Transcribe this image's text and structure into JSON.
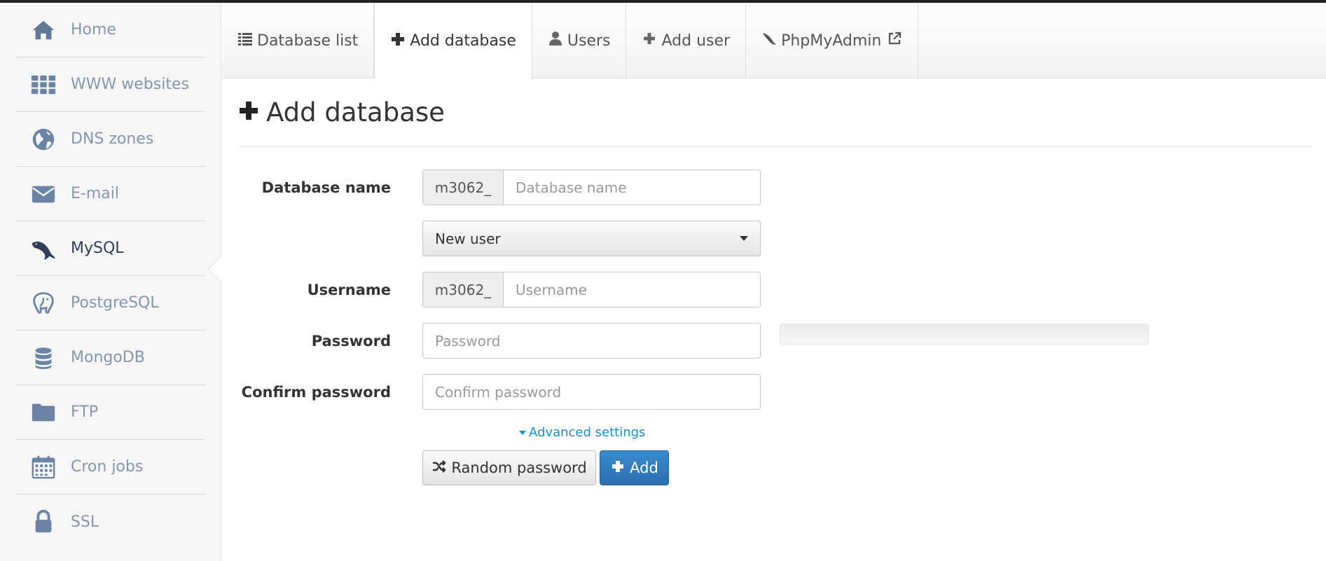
{
  "sidebar": {
    "items": [
      {
        "label": "Home",
        "icon": "home-icon"
      },
      {
        "label": "WWW websites",
        "icon": "grid-icon"
      },
      {
        "label": "DNS zones",
        "icon": "globe-icon"
      },
      {
        "label": "E-mail",
        "icon": "envelope-icon"
      },
      {
        "label": "MySQL",
        "icon": "mysql-dolphin-icon",
        "active": true
      },
      {
        "label": "PostgreSQL",
        "icon": "postgresql-elephant-icon"
      },
      {
        "label": "MongoDB",
        "icon": "database-icon"
      },
      {
        "label": "FTP",
        "icon": "folder-icon"
      },
      {
        "label": "Cron jobs",
        "icon": "calendar-icon"
      },
      {
        "label": "SSL",
        "icon": "lock-icon"
      }
    ]
  },
  "tabs": [
    {
      "label": "Database list",
      "icon": "list-icon"
    },
    {
      "label": "Add database",
      "icon": "plus-icon",
      "active": true
    },
    {
      "label": "Users",
      "icon": "user-icon"
    },
    {
      "label": "Add user",
      "icon": "plus-icon"
    },
    {
      "label": "PhpMyAdmin",
      "icon": "phpmyadmin-icon",
      "external_icon": "external-link-icon"
    }
  ],
  "page": {
    "title": "Add database"
  },
  "form": {
    "database_name": {
      "label": "Database name",
      "prefix": "m3062_",
      "placeholder": "Database name",
      "value": ""
    },
    "user_select": {
      "value": "New user"
    },
    "username": {
      "label": "Username",
      "prefix": "m3062_",
      "placeholder": "Username",
      "value": ""
    },
    "password": {
      "label": "Password",
      "placeholder": "Password",
      "value": ""
    },
    "confirm_password": {
      "label": "Confirm password",
      "placeholder": "Confirm password",
      "value": ""
    },
    "advanced_settings": "Advanced settings",
    "random_password_button": "Random password",
    "add_button": "Add"
  },
  "colors": {
    "sidebar_bg": "#f6f6f6",
    "sidebar_text": "#8596ad",
    "link": "#1a8ed6",
    "primary": "#2f7dc2"
  }
}
